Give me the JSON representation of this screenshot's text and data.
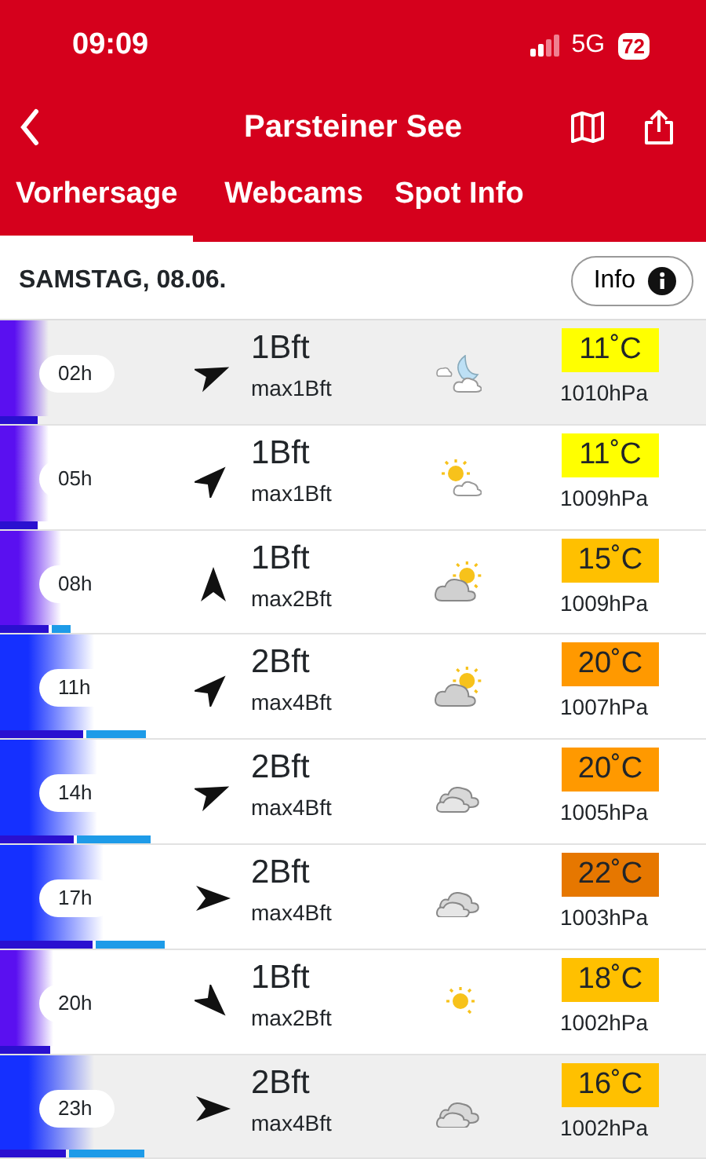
{
  "status_bar": {
    "time": "09:09",
    "network": "5G",
    "battery": "72"
  },
  "header": {
    "title": "Parsteiner See"
  },
  "tabs": [
    {
      "label": "Vorhersage",
      "selected": true
    },
    {
      "label": "Webcams",
      "selected": false
    },
    {
      "label": "Spot Info",
      "selected": false
    }
  ],
  "day": {
    "title": "SAMSTAG, 08.06.",
    "info_button": "Info"
  },
  "rows": [
    {
      "hour": "02h",
      "wind": "1Bft",
      "max": "max1Bft",
      "direction": {
        "kind": "ene"
      },
      "weather": {
        "kind": "moon"
      },
      "temperature": "11˚C",
      "color": "#ffff00",
      "pressure": "1010hPa",
      "shaded": true,
      "wind_bar": {
        "level": 0.053
      }
    },
    {
      "hour": "05h",
      "wind": "1Bft",
      "max": "max1Bft",
      "direction": {
        "kind": "ne"
      },
      "weather": {
        "kind": "sunny"
      },
      "temperature": "11˚C",
      "color": "#ffff00",
      "pressure": "1009hPa",
      "shaded": false,
      "wind_bar": {
        "level": 0.053
      }
    },
    {
      "hour": "08h",
      "wind": "1Bft",
      "max": "max2Bft",
      "direction": {
        "kind": "n"
      },
      "weather": {
        "kind": "partly"
      },
      "temperature": "15˚C",
      "color": "#ffc000",
      "pressure": "1009hPa",
      "shaded": false,
      "wind_bar": {
        "level": 0.069
      },
      "gust_bar": {
        "level": 0.027
      }
    },
    {
      "hour": "11h",
      "wind": "2Bft",
      "max": "max4Bft",
      "direction": {
        "kind": "ne"
      },
      "weather": {
        "kind": "partly"
      },
      "temperature": "20˚C",
      "color": "#ff9900",
      "pressure": "1007hPa",
      "shaded": false,
      "wind_bar": {
        "level": 0.118
      },
      "gust_bar": {
        "level": 0.084
      }
    },
    {
      "hour": "14h",
      "wind": "2Bft",
      "max": "max4Bft",
      "direction": {
        "kind": "ene"
      },
      "weather": {
        "kind": "cloudy"
      },
      "temperature": "20˚C",
      "color": "#ff9900",
      "pressure": "1005hPa",
      "shaded": false,
      "wind_bar": {
        "level": 0.104
      },
      "gust_bar": {
        "level": 0.106
      }
    },
    {
      "hour": "17h",
      "wind": "2Bft",
      "max": "max4Bft",
      "direction": {
        "kind": "e"
      },
      "weather": {
        "kind": "cloudy"
      },
      "temperature": "22˚C",
      "color": "#e67700",
      "pressure": "1003hPa",
      "shaded": false,
      "wind_bar": {
        "level": 0.131
      },
      "gust_bar": {
        "level": 0.098
      }
    },
    {
      "hour": "20h",
      "wind": "1Bft",
      "max": "max2Bft",
      "direction": {
        "kind": "se"
      },
      "weather": {
        "kind": "clear"
      },
      "temperature": "18˚C",
      "color": "#ffc000",
      "pressure": "1002hPa",
      "shaded": false,
      "wind_bar": {
        "level": 0.071
      }
    },
    {
      "hour": "23h",
      "wind": "2Bft",
      "max": "max4Bft",
      "direction": {
        "kind": "e"
      },
      "weather": {
        "kind": "cloudy"
      },
      "temperature": "16˚C",
      "color": "#ffc000",
      "pressure": "1002hPa",
      "shaded": true,
      "wind_bar": {
        "level": 0.093
      },
      "gust_bar": {
        "level": 0.107
      }
    }
  ]
}
